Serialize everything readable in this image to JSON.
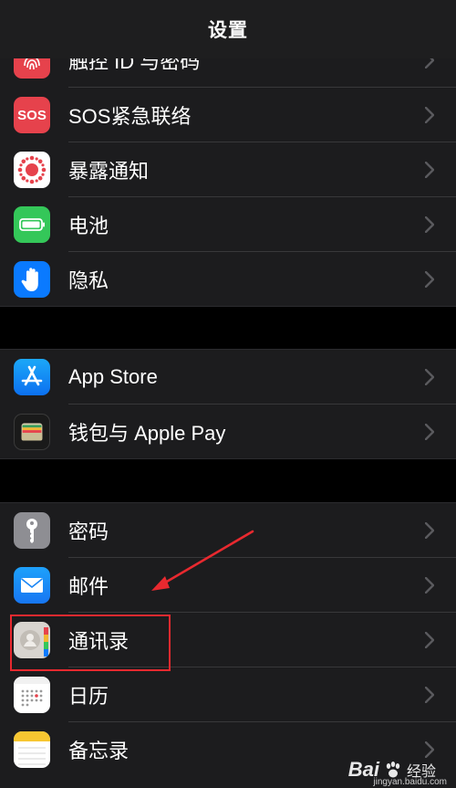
{
  "nav": {
    "title": "设置"
  },
  "sections": [
    {
      "items": [
        {
          "label": "触控 ID 与密码",
          "icon": "fingerprint-icon"
        },
        {
          "label": "SOS紧急联络",
          "icon": "sos-icon",
          "icon_text": "SOS"
        },
        {
          "label": "暴露通知",
          "icon": "exposure-notification-icon"
        },
        {
          "label": "电池",
          "icon": "battery-icon"
        },
        {
          "label": "隐私",
          "icon": "hand-privacy-icon"
        }
      ]
    },
    {
      "items": [
        {
          "label": "App Store",
          "icon": "app-store-icon"
        },
        {
          "label": "钱包与 Apple Pay",
          "icon": "wallet-icon"
        }
      ]
    },
    {
      "items": [
        {
          "label": "密码",
          "icon": "key-icon"
        },
        {
          "label": "邮件",
          "icon": "mail-icon"
        },
        {
          "label": "通讯录",
          "icon": "contacts-icon"
        },
        {
          "label": "日历",
          "icon": "calendar-icon"
        },
        {
          "label": "备忘录",
          "icon": "notes-icon"
        }
      ]
    }
  ],
  "annotation": {
    "highlight_color": "#e8292f"
  },
  "watermark": {
    "brand": "Bai",
    "brand_suffix": "经验",
    "url": "jingyan.baidu.com"
  },
  "colors": {
    "background": "#000000",
    "cell": "#1c1c1e",
    "separator": "#38383a",
    "chevron": "#5a5a5e"
  }
}
